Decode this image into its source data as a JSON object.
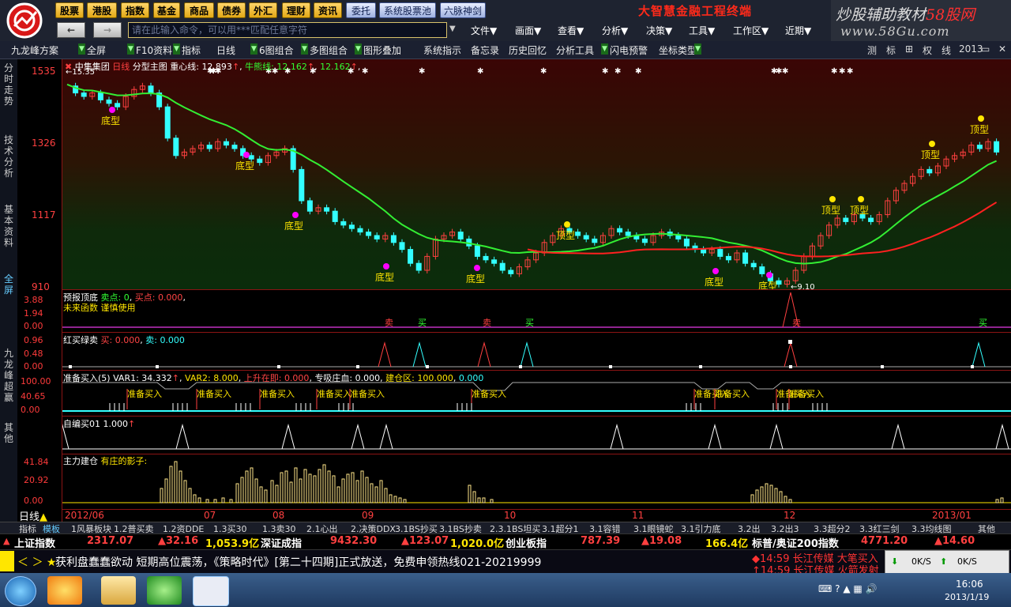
{
  "nav": {
    "buttons": [
      "股票",
      "港股",
      "指数",
      "基金",
      "商品",
      "债券",
      "外汇",
      "理财",
      "资讯"
    ],
    "blue_buttons": [
      "委托",
      "系统股票池",
      "六脉神剑"
    ],
    "brand": "大智慧金融工程终端",
    "promo_line1": "炒股辅助教材",
    "promo_line1_red": "58股网",
    "promo_line2": "www.58Gu.com",
    "back_icon": "←",
    "forward_icon": "→",
    "command_placeholder": "请在此输入命令，可以用***匹配任意字符",
    "menus": [
      "文件▼",
      "画面▼",
      "查看▼",
      "分析▼",
      "决策▼",
      "工具▼",
      "工作区▼",
      "近期▼"
    ]
  },
  "toolbar": {
    "items": [
      "九龙峰方案",
      "全屏",
      "F10资料",
      "指标",
      "日线",
      "6图组合",
      "多图组合",
      "图形叠加",
      "系统指示",
      "备忘录",
      "历史回忆",
      "分析工具",
      "闪电预警",
      "坐标类型"
    ],
    "right_items": [
      "测",
      "标",
      "⊞",
      "权",
      "线",
      "2013",
      "▭",
      "✕"
    ]
  },
  "left_tabs": [
    "分时走势",
    "技术分析",
    "基本资料",
    "全屏",
    "九龙峰超赢",
    "其他"
  ],
  "main_chart": {
    "title": "中集集团",
    "period": "日线",
    "indicator": "分型主图",
    "center_line_label": "重心线:",
    "center_line_value": "12.893",
    "bull_bear_label": "牛熊线:",
    "bull_bear_value": "12.162",
    "second_value": "12.162",
    "y_ticks": [
      "1535",
      "1326",
      "1117",
      "910"
    ],
    "high_label": "15.35",
    "low_label": "9.10",
    "markers": [
      "底型",
      "底型",
      "底型",
      "底型",
      "底型",
      "底型",
      "底型",
      "顶型",
      "顶型",
      "顶型",
      "顶型",
      "顶型"
    ]
  },
  "panels": {
    "p1": {
      "name": "预报顶底",
      "sell_label": "卖点:",
      "sell_value": "0",
      "buy_label": "买点:",
      "buy_value": "0.000",
      "note": "未来函数 谨慎使用",
      "y_ticks": [
        "3.88",
        "1.94",
        "0.00"
      ],
      "marker_buy": "买",
      "marker_sell": "卖"
    },
    "p2": {
      "name": "红买绿卖",
      "buy_label": "买:",
      "buy_value": "0.000",
      "sell_label": "卖:",
      "sell_value": "0.000",
      "y_ticks": [
        "0.96",
        "0.48",
        "0.00"
      ]
    },
    "p3": {
      "name": "准备买入",
      "param": "(5)",
      "var1_label": "VAR1:",
      "var1_value": "34.332",
      "var2_label": "VAR2:",
      "var2_value": "8.000",
      "rise_label": "上升在即:",
      "rise_value": "0.000",
      "absorb_label": "专吸庄血:",
      "absorb_value": "0.000",
      "build_label": "建仓区:",
      "build_value": "100.000",
      "last_value": "0.000",
      "y_ticks": [
        "100.00",
        "40.65",
        "0.00"
      ],
      "buy_tag": "准备买入"
    },
    "p4": {
      "name": "自编买01",
      "value": "1.000"
    },
    "p5": {
      "name": "主力建仓",
      "note": "有庄的影子:",
      "y_ticks": [
        "41.84",
        "20.92",
        "0.00"
      ]
    }
  },
  "date_axis": {
    "period_label": "日线",
    "labels": [
      "2012/06",
      "07",
      "08",
      "09",
      "10",
      "11",
      "12",
      "2013/01"
    ]
  },
  "bottom_tabs": [
    "指标",
    "模板",
    "1风暴板块",
    "1.2普买卖",
    "1.2资DDE",
    "1.3买30",
    "1.3卖30",
    "2.1心出",
    "2.决策DDX",
    "3.1BS抄买",
    "3.1BS抄卖",
    "2.3.1BS坦买",
    "3.1超分1",
    "3.1容错",
    "3.1眼镜蛇",
    "3.1引力底",
    "3.2出",
    "3.2出3",
    "3.3超分2",
    "3.3红三剑",
    "3.3均线图",
    "其他"
  ],
  "ticker": {
    "items": [
      {
        "name": "上证指数",
        "value": "2317.07",
        "change": "▲32.16",
        "amount": "1,053.9亿"
      },
      {
        "name": "深证成指",
        "value": "9432.30",
        "change": "▲123.07",
        "amount": "1,020.0亿"
      },
      {
        "name": "创业板指",
        "value": "787.39",
        "change": "▲19.08",
        "amount": "166.4亿"
      },
      {
        "name": "标普/奥证200指数",
        "value": "4771.20",
        "change": "▲14.60"
      }
    ]
  },
  "news": {
    "nav": "＜ ＞ ★",
    "text": "获利盘蠢蠢欲动 短期高位震荡，《策略时代》[第二十四期]正式放送，免费申领热线021-20219999",
    "right1": "◆14:59 长江传媒 大笔买入",
    "right2": "↑14:59 长江传媒 火箭发射",
    "net1": "0K/S",
    "net2": "0K/S"
  },
  "taskbar": {
    "time": "16:06",
    "date": "2013/1/19"
  },
  "colors": {
    "up": "#ff3333",
    "down": "#00ffff",
    "ma_green": "#33ee33",
    "ma_red": "#ff2020",
    "marker": "#ffe600"
  }
}
